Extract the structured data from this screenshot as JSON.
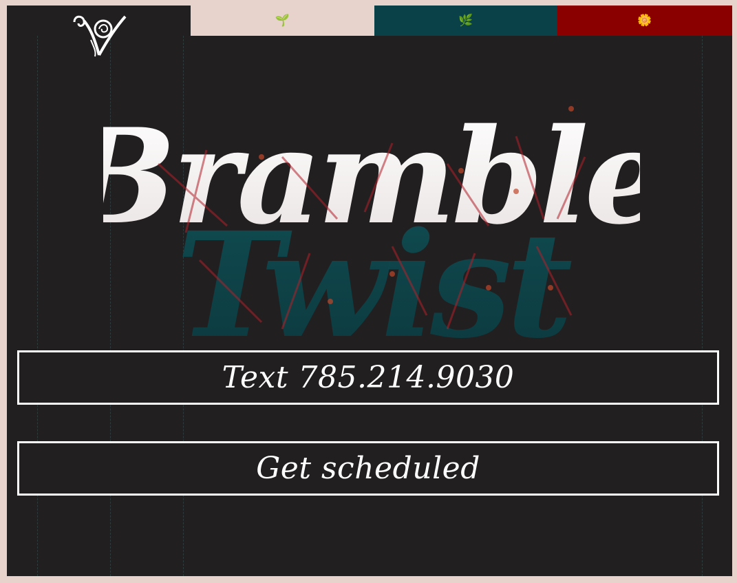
{
  "nav": {
    "tabs": [
      {
        "icon": "seedling-icon",
        "glyph": "🌱",
        "bg": "#e8d2cc"
      },
      {
        "icon": "leaf-icon",
        "glyph": "🌿",
        "bg": "#0a4149"
      },
      {
        "icon": "flower-icon",
        "glyph": "🌼",
        "bg": "#8a0000"
      }
    ]
  },
  "hero": {
    "title_line1": "Bramble",
    "title_line2": "Twist"
  },
  "cta": {
    "text_label": "Text 785.214.9030",
    "schedule_label": "Get scheduled"
  },
  "colors": {
    "page_bg": "#e8d2cc",
    "panel_bg": "#221f21",
    "teal": "#0a4149",
    "red": "#8a0000",
    "title_white": "#ffffff",
    "title_teal": "#0e4f55"
  }
}
